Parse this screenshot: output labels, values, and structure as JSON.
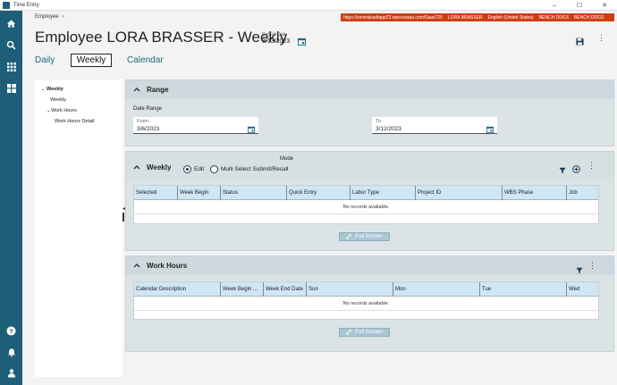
{
  "window": {
    "title": "Time Entry",
    "controls": [
      "–",
      "☐",
      "✕"
    ]
  },
  "breadcrumb": {
    "item": "Employee",
    "separator": "›"
  },
  "urlbar": {
    "segments": [
      "https://centralusdtapp22.epicorsaas.com/Saas725",
      "LORA BRASSER",
      "English (United States)",
      "BENCH DDGS",
      "BENCH DDGS"
    ]
  },
  "header": {
    "title": "Employee LORA BRASSER - Weekly",
    "default_date_label": "Default Date",
    "default_date_value": "3/13/2023"
  },
  "tabs": {
    "daily": "Daily",
    "weekly": "Weekly",
    "calendar": "Calendar"
  },
  "tree": {
    "weekly_root": "Weekly",
    "weekly_child": "Weekly",
    "work_hours": "Work Hours",
    "work_hours_detail": "Work Hours Detail"
  },
  "range_panel": {
    "title": "Range",
    "date_range_label": "Date Range",
    "from_label": "From",
    "from_value": "3/6/2023",
    "to_label": "To",
    "to_value": "3/12/2023"
  },
  "weekly_panel": {
    "title": "Weekly",
    "mode_label": "Mode",
    "mode_edit": "Edit",
    "mode_multi": "Multi Select Submit/Recall",
    "columns": [
      "Selected",
      "Week Begin",
      "Status",
      "Quick Entry",
      "Labor Type",
      "Project ID",
      "WBS Phase",
      "Job"
    ],
    "empty_text": "No records available.",
    "fullscreen_label": "Full Screen"
  },
  "work_hours_panel": {
    "title": "Work Hours",
    "columns": [
      "Calendar Description",
      "Week Begin ...",
      "Week End Date",
      "Sun",
      "Mon",
      "Tue",
      "Wed"
    ],
    "empty_text": "No records available.",
    "fullscreen_label": "Full Screen"
  },
  "colors": {
    "sidebar": "#1e5f78",
    "accent_link": "#1f6680",
    "url_bar": "#cc3e12",
    "grid_header": "#cfe6f3"
  },
  "icons": [
    "home-icon",
    "search-icon",
    "apps-icon",
    "dashboard-icon",
    "help-icon",
    "bell-icon",
    "user-icon",
    "calendar-icon",
    "save-icon",
    "more-icon",
    "filter-icon",
    "add-icon",
    "expand-icon",
    "chevron-up-icon"
  ]
}
